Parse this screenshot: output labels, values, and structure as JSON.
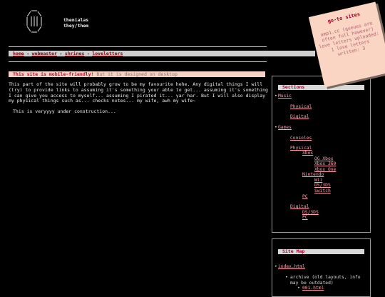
{
  "site": {
    "name": "thenialas",
    "pronouns": "they/them"
  },
  "nav": {
    "links": [
      "home",
      "webmaster",
      "shrines",
      "loveletters"
    ],
    "separator": "✦"
  },
  "notice": {
    "bold": "This site is mobile-friendly!",
    "rest": "But it is designed on desktop"
  },
  "intro": {
    "paragraph": "This part of the site will probably grow to be my favourite hehe. Any digital things I will (try) to provide links to assuming it's something your able to get... assuming it's something I can give you access to myself... assuming I pirated it... yar har. But I will also display my physical things such as... checks notes... my wife, awh my wife~",
    "construction": "This is veryyyy under construction..."
  },
  "sections_panel": {
    "title": "Sections",
    "items": {
      "music": "Music",
      "physical": "Physical",
      "digital": "Digital",
      "games": "Games",
      "consoles": "Consoles",
      "games_physical": "Physical",
      "xbox": "Xbox",
      "og_xbox": "OG Xbox",
      "xbox360": "Xbox 360",
      "xbox_one": "Xbox One",
      "nintendo": "Nintendo",
      "wii": "Wii",
      "ds3ds": "DS/3DS",
      "switch": "Switch",
      "pc": "PC",
      "games_digital": "Digital",
      "digital_ds3ds": "DS/3DS",
      "digital_pc": "PC"
    },
    "bullet": "•"
  },
  "sitemap_panel": {
    "title": "Site Map",
    "index": "index.html",
    "archive": "archive (old layouts, info may be outdated)",
    "archive_first": "001.html"
  },
  "sticky": {
    "title": "go-to sites",
    "body": "amp1.cc (queues are often full however) love letters uploaded: 1 love letters written: 3"
  }
}
